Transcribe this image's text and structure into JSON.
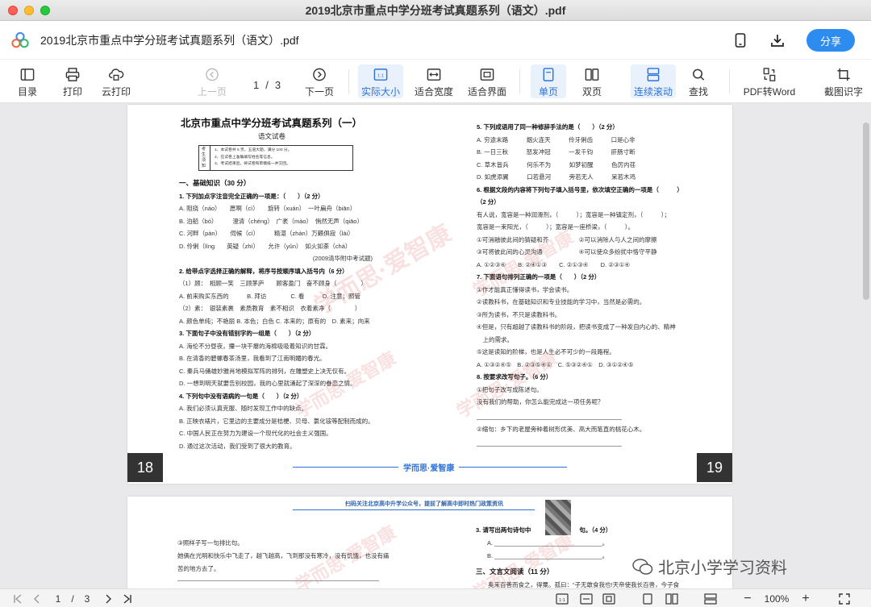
{
  "window": {
    "title": "2019北京市重点中学分班考试真题系列（语文）.pdf"
  },
  "appbar": {
    "doc_title": "2019北京市重点中学分班考试真题系列（语文）.pdf",
    "share_label": "分享"
  },
  "toolbar": {
    "catalog": "目录",
    "print": "打印",
    "cloud_print": "云打印",
    "prev_page": "上一页",
    "current_page": "1",
    "page_sep": "/",
    "total_pages": "3",
    "next_page": "下一页",
    "actual_size": "实际大小",
    "fit_width": "适合宽度",
    "fit_screen": "适合界面",
    "single_page": "单页",
    "double_page": "双页",
    "continuous": "连续滚动",
    "search": "查找",
    "pdf_to_word": "PDF转Word",
    "screenshot_ocr": "截图识字"
  },
  "page_left": {
    "title": "北京市重点中学分班考试真题系列（一）",
    "subtitle": "语文试卷",
    "notice_label": "考生须知",
    "notice": [
      "1、本试卷共 5 页，五道大题，满分 100 分。",
      "2、在试卷上准确填写姓名等信息。",
      "3、考试结束后，将试卷和草稿纸一并交回。"
    ],
    "section1": "一、基础知识（30 分）",
    "q1": "1. 下列加点字注音完全正确的一项是：（　　）（2 分）",
    "q1_a": "A. 阻挠（náo）　　愿啊（cì）　　旋转（xuán）　一叶扁舟（biān）",
    "q1_b": "B. 泊船（bó）　　　澄清（chéng）　广袤（mào）　悄然无声（qiāo）",
    "q1_c": "C. 河畔（pàn）　　伺候（cì）　　　精湛（zhàn）万籁俱寂（lài）",
    "q1_d": "D. 伶俐（líng　　英疑（zhì）　　允许（yǔn）　如火如荼（chá）",
    "q1_src": "(2009清华附中考试题)",
    "q2": "2. 给带点字选择正确的解释，将序号按顺序填入括号内（6 分）",
    "q2_1": "（1）顾：　相顾一笑　三顾茅庐　　顾客盈门　奋不顾身（　　　　）",
    "q2_1o": "A. 前来购买东西的　　　B. 拜访　　　　C. 看　　　D. 注意；照管",
    "q2_2": "（2）素：　银装素裹　素质教育　素不相识　衣着素净（　　　　）",
    "q2_2o": "A. 颜色单纯；不艳丽 B. 本色；白色 C. 本来的；原有的　D. 素来；向来",
    "q3": "3. 下面句子中没有错别字的一组是（　　）（2 分）",
    "q3_a": "A. 海伦不分昼夜，攥一块干瘪的海棉吸吸着知识的甘霖。",
    "q3_b": "B. 在清香的碧螺春茶汤里，我看到了江南明媚的春光。",
    "q3_c": "C. 秦兵马俑雄妙雅肖地模拟军阵的排列，在雕塑史上决无仅有。",
    "q3_d": "D. 一想到明天就要告别校园，我的心里就涌起了深深的眷恋之情。",
    "q4": "4. 下列句中没有语病的一句是（　　）（2 分）",
    "q4_a": "A. 我们必须认真克服、随时发现工作中的缺点。",
    "q4_b": "B. 正映衣裱片，它里边的主要成分是桔梗、贝母、氯化铵等配制而成的。",
    "q4_c": "C. 中国人民正在努力为建设一个现代化的社会主义强国。",
    "q4_d": "D. 通过这次活动，我们受到了很大的教育。",
    "page_num": "18"
  },
  "page_right": {
    "q5": "5. 下列成语用了同一种修辞手法的是（　　）（2 分）",
    "q5_a": "A. 穷途末路　　　烟火连天　　　伶牙俐齿　　　口是心非",
    "q5_b": "B. 一日三秋　　　怒发冲冠　　　一发千钧　　　肝肠寸断",
    "q5_c": "C. 草木皆兵　　　何乐不为　　　如梦初醒　　　色厉内荏",
    "q5_d": "D. 如虎添翼　　　口若悬河　　　旁若无人　　　呆若木鸡",
    "q6": "6. 根据文段的内容将下列句子填入括号里，依次填空正确的一项是（　　　）",
    "q6_pts": "（2 分）",
    "q6_t1": "有人说，宽容是一种润滑剂，（　　　）；宽容是一种镇定剂，（　　　）；",
    "q6_t2": "宽容是一束阳光，（　　　）；宽容是一座桥梁，（　　　）。",
    "q6_o1": "①可消融彼此间的猜疑和芥　　　　　②可以消除人与人之间的摩擦",
    "q6_o2": "③可将彼此间的心灵沟通　　　　　　④可以使众多纷扰中恪守平静",
    "q6_ans": "A. ①②③④　　B. ②④①③　　C. ②①③④　　D. ②③①④",
    "q7": "7. 下面语句排列正确的一项是（　　）（2 分）",
    "q7_1": "①作才能真正懂得读书，学会读书。",
    "q7_2": "②读教科书，在基础知识和专业技能的学习中，当然是必需的。",
    "q7_3": "③所为读书，不只是读教科书。",
    "q7_4": "④但是，只有超越了读教科书的阶段，把读书变成了一种发自内心的、精神",
    "q7_4b": "　上的需求。",
    "q7_5": "⑤这是读知的阶梯，也是人生必不可少的一段路程。",
    "q7_ans": "A. ①③②④⑤　B. ②③⑤④①　C. ⑤③②④①　D. ③①②④⑤",
    "q8": "8. 按要求改写句子。（6 分）",
    "q8_1": "①把句子改写成陈述句。",
    "q8_1t": "没有我们的帮助，你怎么能完成这一项任务呢？",
    "q8_2": "②缩句：乡下的老屋旁种着树形优美、高大而笔直的桃花心木。",
    "page_num": "19"
  },
  "footer_brand": "学而思·爱智康",
  "watermark": "学而思·爱智康",
  "page2": {
    "header": "扫码关注北京高中升学公众号，提前了解高中即时热门政策资讯",
    "l1": "③照样子写一句排比句。",
    "l2": "她俩在光明和快乐中飞走了，越飞越高，飞到那没有寒冷，没有饥饿，也没有痛",
    "l3": "苦的地方去了。",
    "r1": "3. 请写出两句诗句中　　　　　　　　句。（4 分）",
    "r2": "A. ________________________________。",
    "r3": "B. ________________________________。",
    "r4": "三、文言文阅读（11 分）",
    "r5": "　　奥来百善而食之，得粟。孤曰：“子无敢食我也!天帝使我长百兽，今子食"
  },
  "overlay": {
    "wechat_mark": "北京小学学习资料"
  },
  "statusbar": {
    "current_page": "1",
    "sep": "/",
    "total": "3",
    "zoom": "100%",
    "zoom_minus": "−",
    "zoom_plus": "+"
  }
}
